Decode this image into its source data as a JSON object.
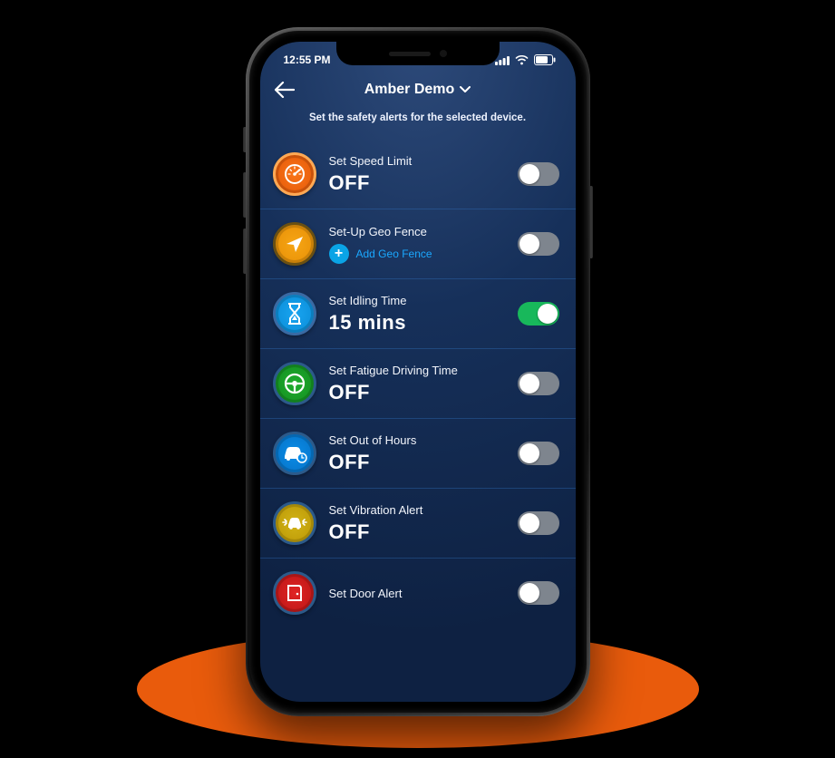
{
  "status": {
    "time": "12:55 PM"
  },
  "header": {
    "title": "Amber Demo"
  },
  "subtitle": "Set the safety alerts for the selected device.",
  "alerts": [
    {
      "label": "Set Speed Limit",
      "value": "OFF",
      "on": false,
      "icon": "speedometer",
      "bg": "bg-orange"
    },
    {
      "label": "Set-Up Geo Fence",
      "action": "Add Geo Fence",
      "on": false,
      "icon": "nav-arrow",
      "bg": "bg-amber"
    },
    {
      "label": "Set Idling Time",
      "value": "15 mins",
      "on": true,
      "icon": "hourglass",
      "bg": "bg-blue"
    },
    {
      "label": "Set Fatigue Driving Time",
      "value": "OFF",
      "on": false,
      "icon": "steering",
      "bg": "bg-green"
    },
    {
      "label": "Set Out of Hours",
      "value": "OFF",
      "on": false,
      "icon": "car-clock",
      "bg": "bg-blue2"
    },
    {
      "label": "Set Vibration Alert",
      "value": "OFF",
      "on": false,
      "icon": "vibration",
      "bg": "bg-yellow"
    },
    {
      "label": "Set Door Alert",
      "value": "",
      "on": false,
      "icon": "door",
      "bg": "bg-red"
    }
  ]
}
